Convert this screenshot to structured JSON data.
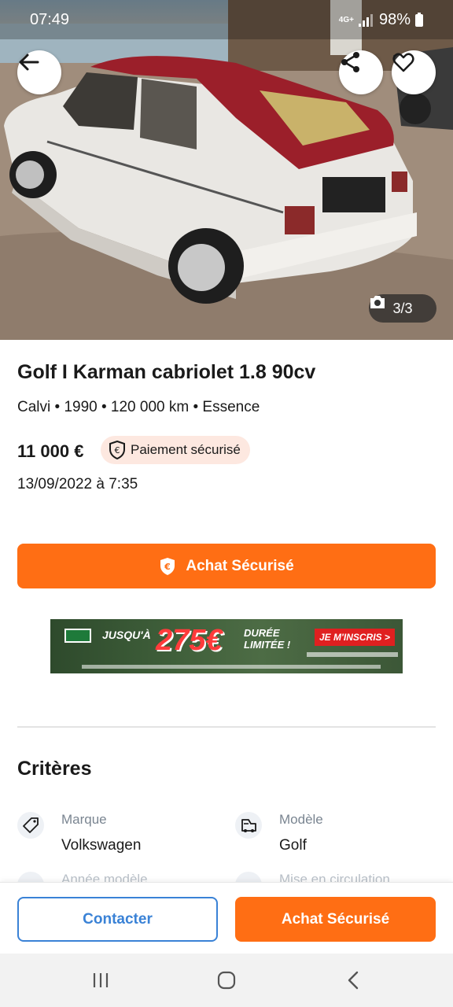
{
  "status_bar": {
    "time": "07:49",
    "network": "4G+",
    "battery": "98%"
  },
  "gallery": {
    "counter": "3/3"
  },
  "listing": {
    "title": "Golf I Karman cabriolet 1.8 90cv",
    "subtitle": "Calvi • 1990 • 120 000 km • Essence",
    "price": "11 000 €",
    "payment_badge": "Paiement sécurisé",
    "date": "13/09/2022 à 7:35"
  },
  "cta": {
    "label": "Achat Sécurisé"
  },
  "ad": {
    "text_upto": "JUSQU'À",
    "amount": "275€",
    "text_duration": "DURÉE LIMITÉE !",
    "button": "JE M'INSCRIS >"
  },
  "criteria": {
    "section_title": "Critères",
    "items": [
      {
        "label": "Marque",
        "value": "Volkswagen",
        "icon": "tag-icon"
      },
      {
        "label": "Modèle",
        "value": "Golf",
        "icon": "car-model-icon"
      }
    ],
    "peek_labels": [
      "Année modèle",
      "Mise en circulation"
    ]
  },
  "bottom_bar": {
    "contact": "Contacter",
    "buy": "Achat Sécurisé"
  },
  "colors": {
    "accent": "#ff6e14",
    "link_blue": "#3a82d6",
    "badge_bg": "#fde8e0"
  }
}
